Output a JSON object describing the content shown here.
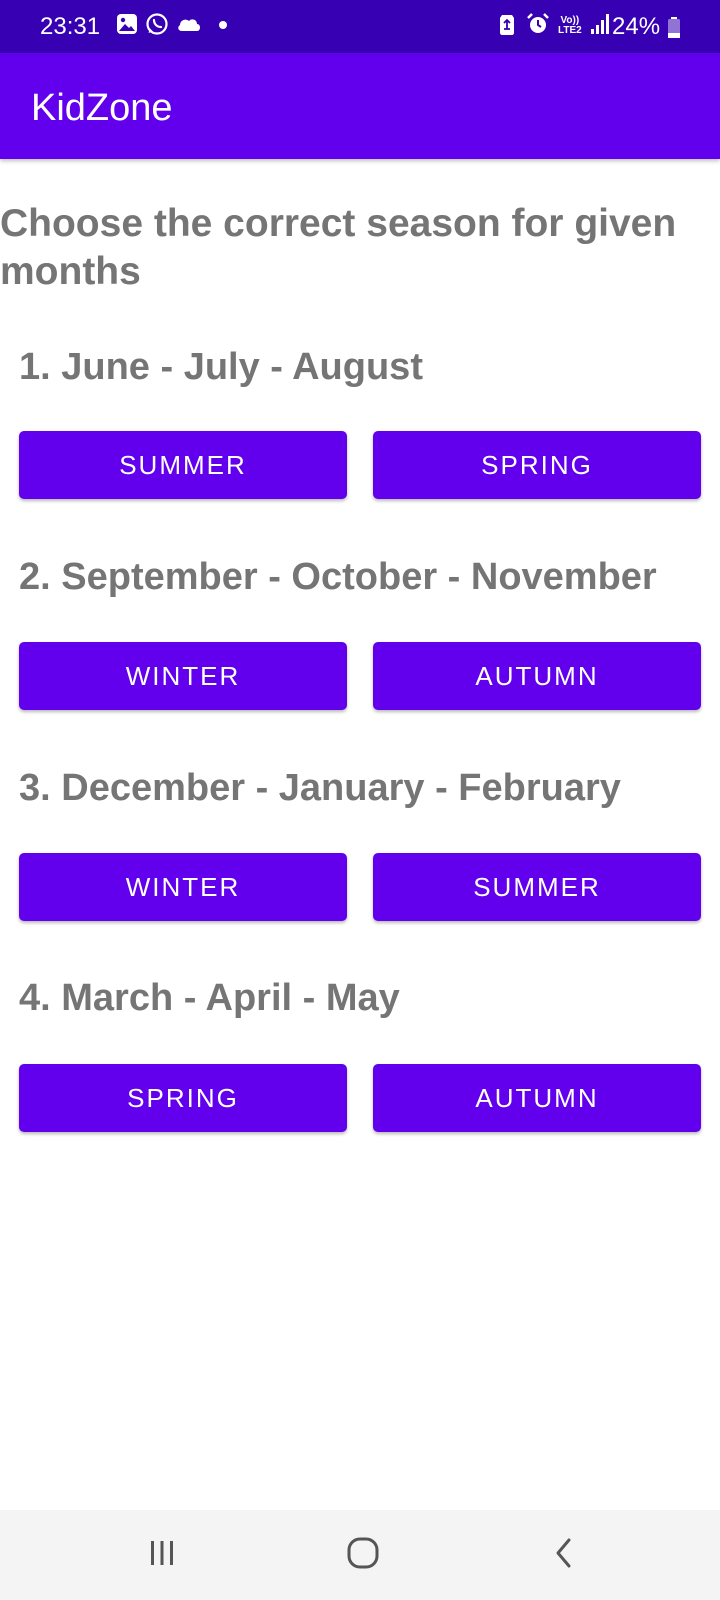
{
  "status_bar": {
    "time": "23:31",
    "battery_percent": "24%",
    "battery_level": 0.24,
    "network_label_top": "Vo))",
    "network_label_bottom": "LTE2",
    "left_icons": [
      "gallery-icon",
      "whatsapp-icon",
      "cloud-icon",
      "dot-icon"
    ],
    "right_icons": [
      "recycle-icon",
      "alarm-icon",
      "volte-icon",
      "signal-icon",
      "battery-icon"
    ]
  },
  "app_bar": {
    "title": "KidZone",
    "color": "#6200EE"
  },
  "instruction": "Choose the correct season for given months",
  "questions": [
    {
      "text": "1. June - July - August",
      "options": [
        "SUMMER",
        "SPRING"
      ]
    },
    {
      "text": "2. September - October - November",
      "options": [
        "WINTER",
        "AUTUMN"
      ]
    },
    {
      "text": "3. December - January - February",
      "options": [
        "WINTER",
        "SUMMER"
      ]
    },
    {
      "text": "4. March - April - May",
      "options": [
        "SPRING",
        "AUTUMN"
      ]
    }
  ],
  "colors": {
    "status_bar": "#3700B3",
    "primary": "#6200EE",
    "question_text": "#757575",
    "nav_bar": "#F4F4F4"
  },
  "nav_bar": {
    "icons": [
      "recent-apps-icon",
      "home-icon",
      "back-icon"
    ]
  }
}
